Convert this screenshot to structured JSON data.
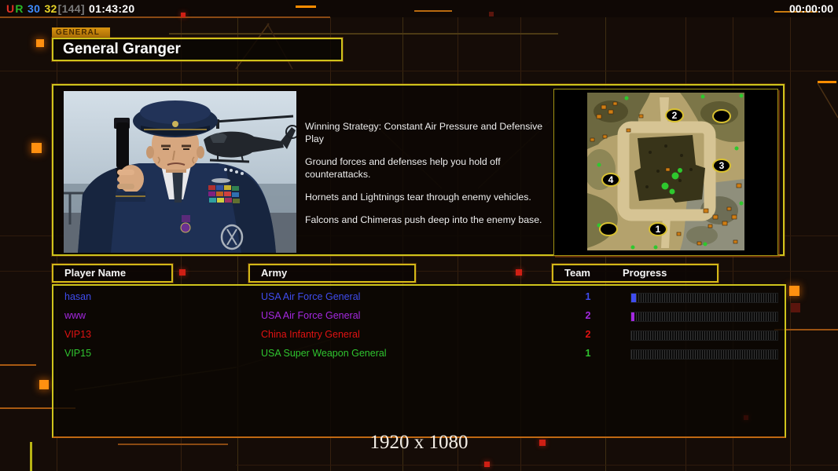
{
  "hud": {
    "stat_u": "U",
    "stat_r": "R",
    "stat_a": "30",
    "stat_b": "32",
    "stat_bracket": "[144]",
    "stat_time": "01:43:20",
    "match_time": "00:00:00",
    "colors": {
      "u": "#e03224",
      "r": "#28b828",
      "a": "#3f8cff",
      "b": "#e8d428",
      "bracket": "#7a7a7a",
      "time": "#ffffff"
    }
  },
  "panel": {
    "tab": "GENERAL",
    "title": "General Granger",
    "strategy": [
      "Winning Strategy: Constant Air Pressure and Defensive Play",
      "Ground forces and defenses help you hold off counterattacks.",
      "Hornets and Lightnings tear through enemy vehicles.",
      "Falcons and Chimeras push deep into the enemy base."
    ]
  },
  "map": {
    "markers": [
      {
        "label": "2"
      },
      {
        "label": ""
      },
      {
        "label": "3"
      },
      {
        "label": "4"
      },
      {
        "label": ""
      },
      {
        "label": "1"
      }
    ]
  },
  "table": {
    "headers": {
      "player": "Player Name",
      "army": "Army",
      "team": "Team",
      "progress": "Progress"
    },
    "rows": [
      {
        "name": "hasan",
        "army": "USA Air Force General",
        "team": "1",
        "color": "#3f4cee",
        "progress": 3
      },
      {
        "name": "www",
        "army": "USA Air Force General",
        "team": "2",
        "color": "#a428e0",
        "progress": 2
      },
      {
        "name": "VIP13",
        "army": "China Infantry General",
        "team": "2",
        "color": "#e01212",
        "progress": 0
      },
      {
        "name": "VIP15",
        "army": "USA Super Weapon General",
        "team": "1",
        "color": "#2fc42f",
        "progress": 0
      }
    ]
  },
  "footer": {
    "resolution": "1920 x 1080"
  },
  "colors": {
    "panel_border": "#cfc41c",
    "accent_orange": "#ff8c00"
  }
}
